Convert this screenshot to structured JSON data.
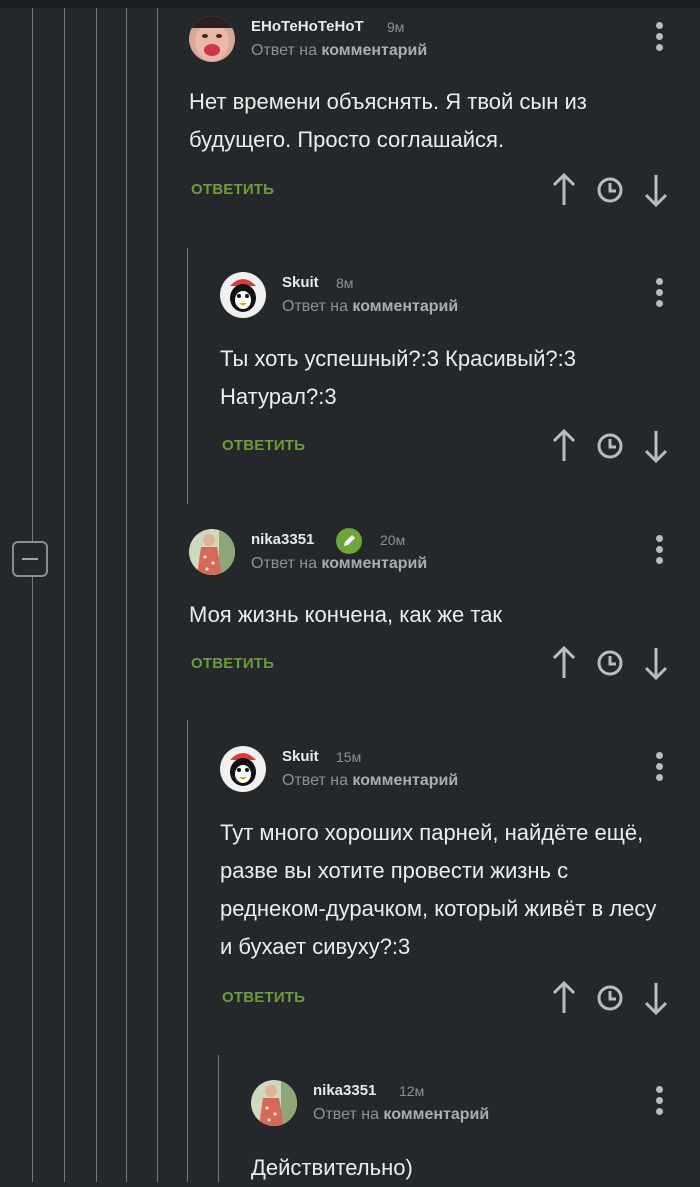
{
  "reply_prefix": "Ответ на",
  "reply_target": "комментарий",
  "reply_label": "ОТВЕТИТЬ",
  "comments": [
    {
      "username": "ЕНоТеНоТеНоТ",
      "time": "9м",
      "text": "Нет времени объяснять. Я твой сын из будущего. Просто соглашайся.",
      "avatar": "person-photo"
    },
    {
      "username": "Skuit",
      "time": "8м",
      "text": "Ты хоть успешный?:3 Красивый?:3 Натурал?:3",
      "avatar": "cartoon-penguin"
    },
    {
      "username": "nika3351",
      "time": "20м",
      "text": "Моя жизнь кончена, как же так",
      "avatar": "woman-photo",
      "badge": "pencil-icon"
    },
    {
      "username": "Skuit",
      "time": "15м",
      "text": "Тут много хороших парней, найдёте ещё, разве вы хотите провести жизнь с реднеком-дурачком, который живёт в лесу и бухает сивуху?:3",
      "avatar": "cartoon-penguin"
    },
    {
      "username": "nika3351",
      "time": "12м",
      "text": "Действительно)",
      "avatar": "woman-photo"
    }
  ],
  "colors": {
    "background": "#25282b",
    "reply_link": "#6c9c3a",
    "badge": "#6ca53a"
  }
}
